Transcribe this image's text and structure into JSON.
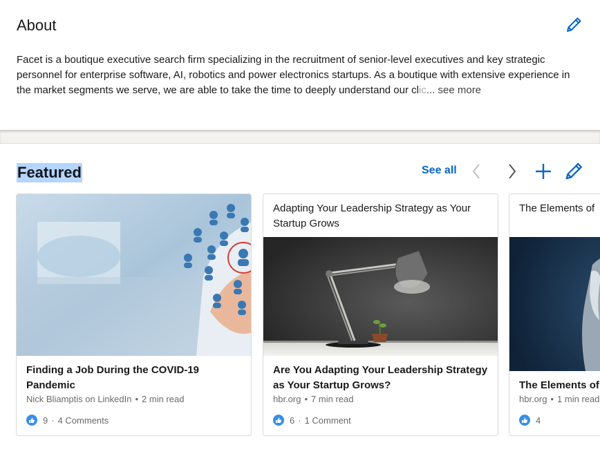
{
  "about": {
    "title": "About",
    "edit_icon": "pencil-icon",
    "text_main": "Facet is a boutique executive search firm specializing in the recruitment of senior-level executives and key strategic personnel for enterprise software, AI, robotics and power electronics startups. As a boutique with extensive experience in the market segments we serve, we are able to take the time to deeply understand our cl",
    "text_fade": "ic",
    "see_more": "... see more"
  },
  "featured": {
    "title": "Featured",
    "see_all": "See all",
    "icons": {
      "prev": "chevron-left-icon",
      "next": "chevron-right-icon",
      "add": "plus-icon",
      "edit": "pencil-icon"
    },
    "cards": [
      {
        "title": "Finding a Job During the COVID-19 Pandemic",
        "meta_source": "Nick Bliamptis on LinkedIn",
        "meta_time": "2 min read",
        "likes": "9",
        "comments": "4 Comments"
      },
      {
        "header": "Adapting Your Leadership Strategy as Your Startup Grows",
        "title": "Are You Adapting Your Leadership Strategy as Your Startup Grows?",
        "meta_source": "hbr.org",
        "meta_time": "7 min read",
        "likes": "6",
        "comments": "1 Comment"
      },
      {
        "header": "The Elements of",
        "title": "The Elements of",
        "meta_source": "hbr.org",
        "meta_time": "1 min read",
        "likes": "4"
      }
    ]
  },
  "colors": {
    "accent": "#0a66c2",
    "like": "#378fe9",
    "selection": "#b4d5fe"
  }
}
